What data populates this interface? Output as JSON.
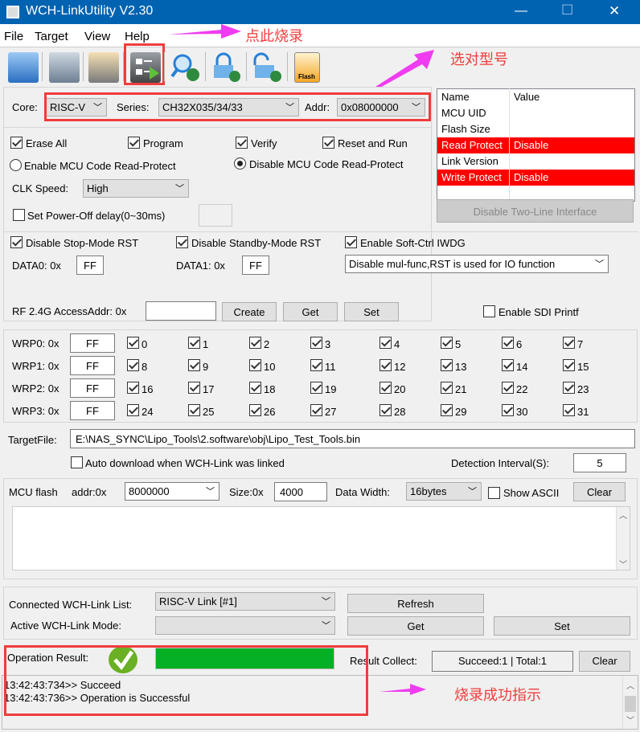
{
  "window": {
    "title": "WCH-LinkUtility V2.30",
    "minimize": "—",
    "maximize": "☐",
    "close": "✕"
  },
  "menu": [
    "File",
    "Target",
    "View",
    "Help"
  ],
  "toolbar": [
    "open-file",
    "target-config",
    "read-chip",
    "program",
    "query-info",
    "lock-protect",
    "unlock-protect",
    "flash"
  ],
  "toolbar_flash_label": "Flash",
  "annotations": {
    "click_to_program": "点此烧录",
    "select_model": "选对型号",
    "success_indicator": "烧录成功指示"
  },
  "target": {
    "core_label": "Core:",
    "core": "RISC-V",
    "series_label": "Series:",
    "series": "CH32X035/34/33",
    "addr_label": "Addr:",
    "addr": "0x08000000"
  },
  "info_table": {
    "headers": [
      "Name",
      "Value"
    ],
    "rows": [
      [
        "MCU UID",
        ""
      ],
      [
        "Flash Size",
        ""
      ],
      [
        "Read Protect",
        "Disable"
      ],
      [
        "Link Version",
        ""
      ],
      [
        "Write Protect",
        "Disable"
      ]
    ]
  },
  "disable_two_line": "Disable Two-Line Interface",
  "options": {
    "erase_all": "Erase All",
    "program": "Program",
    "verify": "Verify",
    "reset_run": "Reset and Run",
    "enable_rp": "Enable MCU Code Read-Protect",
    "disable_rp": "Disable MCU Code Read-Protect",
    "clk_label": "CLK Speed:",
    "clk": "High",
    "power_off": "Set Power-Off delay(0~30ms)"
  },
  "opt_bytes": {
    "stop_rst": "Disable Stop-Mode RST",
    "standby_rst": "Disable Standby-Mode RST",
    "soft_iwdg": "Enable Soft-Ctrl IWDG",
    "data0_label": "DATA0: 0x",
    "data0": "FF",
    "data1_label": "DATA1: 0x",
    "data1": "FF",
    "rst_mode": "Disable mul-func,RST is used for IO function"
  },
  "rf": {
    "label": "RF 2.4G AccessAddr: 0x",
    "value": "",
    "create": "Create",
    "get": "Get",
    "set": "Set",
    "sdi": "Enable SDI Printf"
  },
  "wrp": [
    {
      "label": "WRP0: 0x",
      "value": "FF"
    },
    {
      "label": "WRP1: 0x",
      "value": "FF"
    },
    {
      "label": "WRP2: 0x",
      "value": "FF"
    },
    {
      "label": "WRP3: 0x",
      "value": "FF"
    }
  ],
  "target_file": {
    "label": "TargetFile:",
    "path": "E:\\NAS_SYNC\\Lipo_Tools\\2.software\\obj\\Lipo_Test_Tools.bin",
    "auto_download": "Auto download when WCH-Link was linked",
    "interval_label": "Detection Interval(S):",
    "interval": "5"
  },
  "mcu_flash": {
    "label": "MCU flash",
    "addr_label": "addr:0x",
    "addr": "8000000",
    "size_label": "Size:0x",
    "size": "4000",
    "width_label": "Data Width:",
    "width": "16bytes",
    "show_ascii": "Show ASCII",
    "clear": "Clear"
  },
  "link": {
    "list_label": "Connected WCH-Link List:",
    "list": "RISC-V Link [#1]",
    "refresh": "Refresh",
    "mode_label": "Active WCH-Link  Mode:",
    "mode": "",
    "get": "Get",
    "set": "Set"
  },
  "result": {
    "label": "Operation Result:",
    "progress": 1.0,
    "collect_label": "Result Collect:",
    "collect": "Succeed:1 | Total:1",
    "clear": "Clear",
    "log": [
      "13:42:43:734>> Succeed",
      "13:42:43:736>> Operation is Successful"
    ]
  }
}
